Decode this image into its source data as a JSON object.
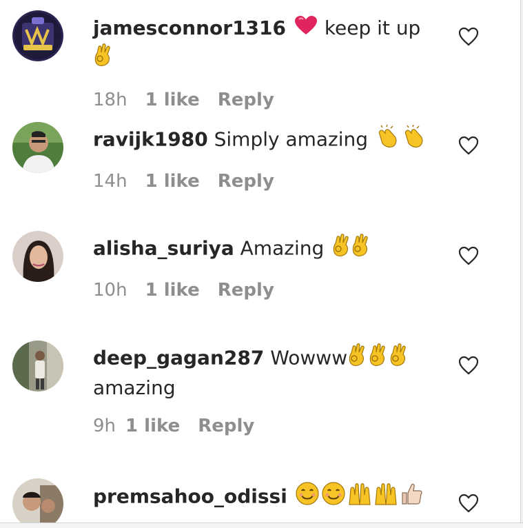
{
  "comments": [
    {
      "username": "jamesconnor1316",
      "text_before": "",
      "text_after": "keep it up",
      "second_line": "",
      "time": "18h",
      "likes": "1 like",
      "reply": "Reply"
    },
    {
      "username": "ravijk1980",
      "text_before": "Simply amazing",
      "text_after": "",
      "second_line": "",
      "time": "14h",
      "likes": "1 like",
      "reply": "Reply"
    },
    {
      "username": "alisha_suriya",
      "text_before": "Amazing",
      "text_after": "",
      "second_line": "",
      "time": "10h",
      "likes": "1 like",
      "reply": "Reply"
    },
    {
      "username": "deep_gagan287",
      "text_before": "Wowww",
      "text_after": "",
      "second_line": "amazing",
      "time": "9h",
      "likes": "1 like",
      "reply": "Reply"
    },
    {
      "username": "premsahoo_odissi",
      "text_before": "",
      "text_after": "",
      "second_line": "",
      "time": "",
      "likes": "",
      "reply": ""
    }
  ],
  "icons": {
    "like": "heart-outline-icon",
    "heart_emoji": "red-heart-emoji",
    "ok_hand": "ok-hand-emoji",
    "clap": "clapping-hands-emoji",
    "smile": "smiling-face-emoji",
    "raised_hands": "raised-hands-emoji",
    "thumbs_up": "thumbs-up-emoji"
  },
  "colors": {
    "text": "#262626",
    "meta": "#8e8e8e",
    "emoji_yellow": "#f7c325",
    "heart_red": "#e0245e"
  }
}
